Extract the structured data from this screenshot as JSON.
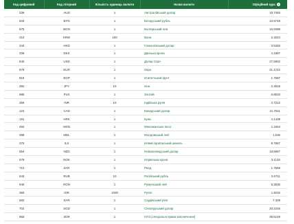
{
  "header": {
    "code_digital": "Код цифровий",
    "code_letter": "Код літерний",
    "units": "Кількість одиниць валюти",
    "name": "Назва валюти",
    "rate": "Офіційний курс",
    "rate_info_icon": "info-icon"
  },
  "rows": [
    {
      "code": "036",
      "letter": "AUD",
      "units": "1",
      "name": "Австралійський долар",
      "rate": "19.7393"
    },
    {
      "code": "933",
      "letter": "BYN",
      "units": "1",
      "name": "Білоруський рубль",
      "rate": "10.6748"
    },
    {
      "code": "975",
      "letter": "BGN",
      "units": "1",
      "name": "Болгарський лев",
      "rate": "15.9498"
    },
    {
      "code": "410",
      "letter": "KRW",
      "units": "100",
      "name": "Вона",
      "rate": "2.3024"
    },
    {
      "code": "344",
      "letter": "HKD",
      "units": "1",
      "name": "Гонконгівський долар",
      "rate": "3.5283"
    },
    {
      "code": "208",
      "letter": "DKK",
      "units": "1",
      "name": "Данська крона",
      "rate": "4.1897"
    },
    {
      "code": "840",
      "letter": "USD",
      "units": "1",
      "name": "Долар США",
      "rate": "27.6902"
    },
    {
      "code": "978",
      "letter": "EUR",
      "units": "1",
      "name": "Євро",
      "rate": "31.1722"
    },
    {
      "code": "818",
      "letter": "EGP",
      "units": "1",
      "name": "Єгипетський фунт",
      "rate": "1.7587"
    },
    {
      "code": "392",
      "letter": "JPY",
      "units": "10",
      "name": "Єна",
      "rate": "2.3919"
    },
    {
      "code": "985",
      "letter": "PLN",
      "units": "1",
      "name": "Злотий",
      "rate": "6.8633"
    },
    {
      "code": "356",
      "letter": "INR",
      "units": "10",
      "name": "Індійська рупія",
      "rate": "3.7212"
    },
    {
      "code": "124",
      "letter": "CAD",
      "units": "1",
      "name": "Канадський долар",
      "rate": "21.7611"
    },
    {
      "code": "191",
      "letter": "HRK",
      "units": "1",
      "name": "Куна",
      "rate": "4.1439"
    },
    {
      "code": "484",
      "letter": "MXN",
      "units": "1",
      "name": "Мексиканське песо",
      "rate": "1.3464"
    },
    {
      "code": "498",
      "letter": "MDL",
      "units": "1",
      "name": "Молдовський лей",
      "rate": "1.536"
    },
    {
      "code": "376",
      "letter": "ILS",
      "units": "1",
      "name": "Новий ізраїльський шекель",
      "rate": "8.7867"
    },
    {
      "code": "554",
      "letter": "NZD",
      "units": "1",
      "name": "Новозеландський долар",
      "rate": "18.5867"
    },
    {
      "code": "578",
      "letter": "NOK",
      "units": "1",
      "name": "Норвезька крона",
      "rate": "3.1146"
    },
    {
      "code": "710",
      "letter": "ZAR",
      "units": "1",
      "name": "Ренд",
      "rate": "1.7568"
    },
    {
      "code": "643",
      "letter": "RUB",
      "units": "10",
      "name": "Російський рубль",
      "rate": "3.6711"
    },
    {
      "code": "946",
      "letter": "RON",
      "units": "1",
      "name": "Румунський лей",
      "rate": "6.3535"
    },
    {
      "code": "360",
      "letter": "IDR",
      "units": "1000",
      "name": "Рупія",
      "rate": "1.9232"
    },
    {
      "code": "682",
      "letter": "SAR",
      "units": "1",
      "name": "Саудівський ріял",
      "rate": "7.329"
    },
    {
      "code": "702",
      "letter": "SGD",
      "units": "1",
      "name": "Сінгапурський долар",
      "rate": "20.3246"
    },
    {
      "code": "960",
      "letter": "XDR",
      "units": "1",
      "name": "СПЗ (спеціальні права запозичення)",
      "rate": "38.5149"
    }
  ]
}
